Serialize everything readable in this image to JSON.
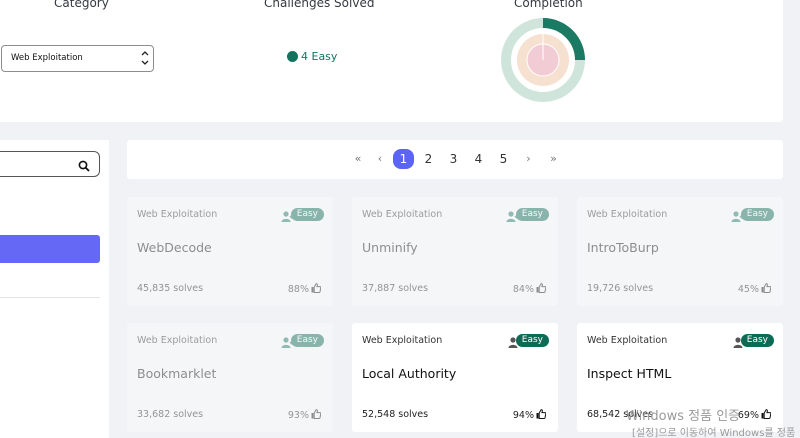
{
  "stats": {
    "category_header": "Category",
    "challenges_header": "Challenges Solved",
    "completion_header": "Completion",
    "selected_category": "Web Exploitation",
    "solved_text": "4 Easy",
    "easy_color": "#14735f",
    "completion": {
      "outer_fraction": 0.25
    }
  },
  "pagination": {
    "first": "«",
    "prev": "‹",
    "pages": [
      "1",
      "2",
      "3",
      "4",
      "5"
    ],
    "active_page": "1",
    "next": "›",
    "last": "»"
  },
  "cards": [
    {
      "category": "Web Exploitation",
      "difficulty": "Easy",
      "title": "WebDecode",
      "solves": "45,835 solves",
      "rating": "88%",
      "solved": true
    },
    {
      "category": "Web Exploitation",
      "difficulty": "Easy",
      "title": "Unminify",
      "solves": "37,887 solves",
      "rating": "84%",
      "solved": true
    },
    {
      "category": "Web Exploitation",
      "difficulty": "Easy",
      "title": "IntroToBurp",
      "solves": "19,726 solves",
      "rating": "45%",
      "solved": true
    },
    {
      "category": "Web Exploitation",
      "difficulty": "Easy",
      "title": "Bookmarklet",
      "solves": "33,682 solves",
      "rating": "93%",
      "solved": true
    },
    {
      "category": "Web Exploitation",
      "difficulty": "Easy",
      "title": "Local Authority",
      "solves": "52,548 solves",
      "rating": "94%",
      "solved": false
    },
    {
      "category": "Web Exploitation",
      "difficulty": "Easy",
      "title": "Inspect HTML",
      "solves": "68,542 solves",
      "rating": "69%",
      "solved": false
    }
  ],
  "watermark": {
    "line1": "Windows 정품 인증",
    "line2": "[설정]으로 이동하여 Windows를 정품"
  },
  "icons": {
    "search": "search-icon",
    "user": "user-icon",
    "thumb": "thumbs-up-icon",
    "select": "chevron-updown-icon"
  }
}
